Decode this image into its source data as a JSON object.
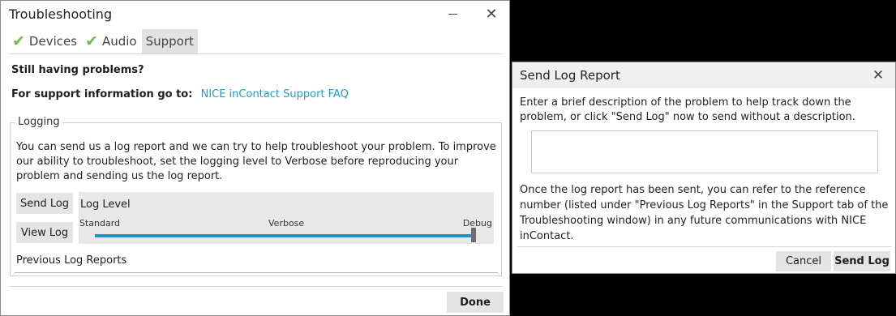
{
  "troubleshooting": {
    "title": "Troubleshooting",
    "tabs": [
      {
        "label": "Devices",
        "checked": true
      },
      {
        "label": "Audio",
        "checked": true
      },
      {
        "label": "Support",
        "checked": false,
        "active": true
      }
    ],
    "still_problems": "Still having problems?",
    "support_label": "For support information go to:",
    "support_link": "NICE inContact Support FAQ",
    "logging": {
      "legend": "Logging",
      "description": "You can send us a log report and we can try to help troubleshoot your problem. To improve our ability to troubleshoot, set the logging level to Verbose before reproducing your problem and sending us the log report.",
      "send_log_label": "Send Log",
      "view_log_label": "View Log",
      "log_level": {
        "title": "Log Level",
        "options": [
          "Standard",
          "Verbose",
          "Debug"
        ],
        "selected": "Debug"
      },
      "previous_reports_label": "Previous Log Reports"
    },
    "done_label": "Done"
  },
  "send_log_report": {
    "title": "Send Log Report",
    "instructions": "Enter a brief description of the problem to help track down the problem, or click \"Send Log\" now to send without a description.",
    "description_value": "",
    "after_text": "Once the log report has been sent, you can refer to the reference number (listed under \"Previous Log Reports\" in the Support tab of the Troubleshooting window) in any future communications with NICE inContact.",
    "cancel_label": "Cancel",
    "send_label": "Send Log"
  },
  "colors": {
    "accent": "#1b95c9",
    "link": "#1a9cd8",
    "check": "#6fbe44",
    "button_bg": "#e4e4e4"
  }
}
